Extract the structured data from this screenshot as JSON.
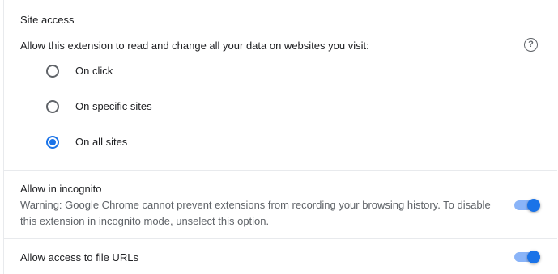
{
  "site_access": {
    "title": "Site access",
    "prompt": "Allow this extension to read and change all your data on websites you visit:",
    "help_icon": "help-circle-icon",
    "options": [
      {
        "label": "On click",
        "selected": false
      },
      {
        "label": "On specific sites",
        "selected": false
      },
      {
        "label": "On all sites",
        "selected": true
      }
    ]
  },
  "incognito": {
    "title": "Allow in incognito",
    "warning": "Warning: Google Chrome cannot prevent extensions from recording your browsing history. To disable this extension in incognito mode, unselect this option.",
    "enabled": true
  },
  "file_urls": {
    "title": "Allow access to file URLs",
    "enabled": true
  },
  "colors": {
    "accent": "#1a73e8",
    "toggle_track": "#8ab4f8",
    "secondary_text": "#5f6368",
    "divider": "#e8eaed"
  }
}
